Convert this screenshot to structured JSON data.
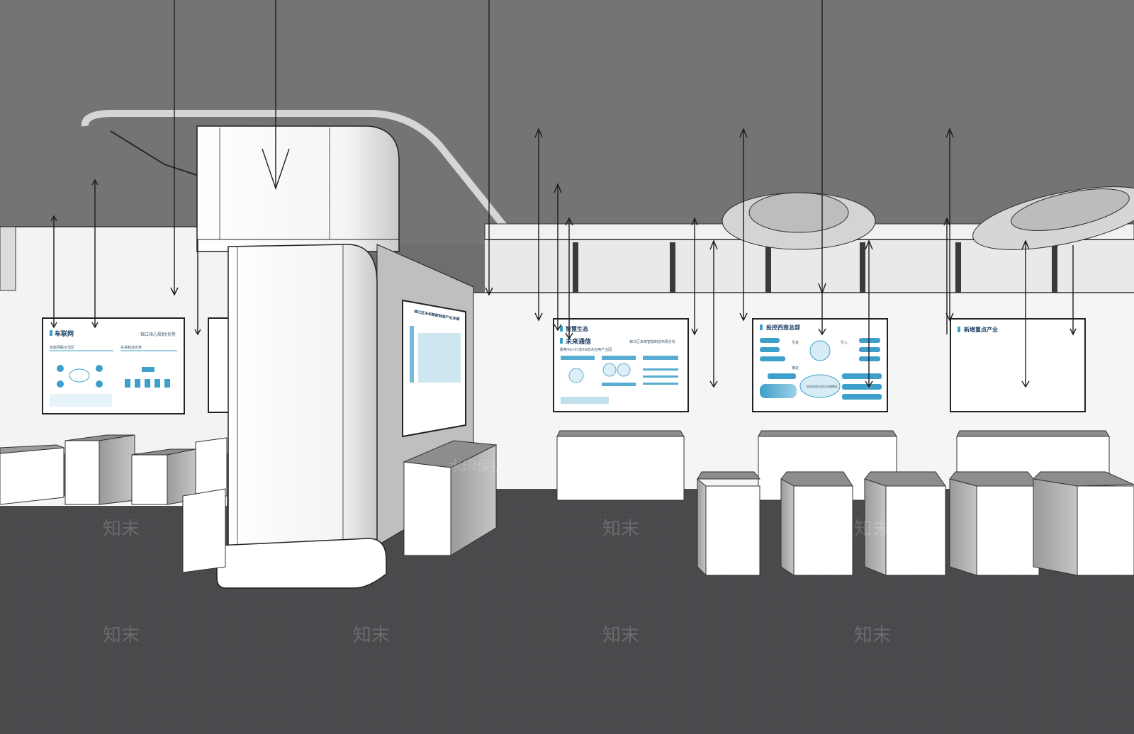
{
  "scene": {
    "colors": {
      "ceiling": "#747474",
      "floor": "#4a4a4d",
      "wall": "#f4f4f4",
      "accent": "#3d9fca",
      "board_title": "#1b3f63"
    }
  },
  "boards": {
    "left": {
      "title": "车联网",
      "right_title": "锦江核心规划/优势",
      "section_1": "智能网联示范区",
      "section_2": "先进制造优势"
    },
    "pillar": {
      "title": "锦江区未来智能制造产业发展"
    },
    "center": {
      "title": "智慧生态",
      "subtitle": "未来通信",
      "right_note": "锦江区未来智能制造布局分析",
      "section": "聚焦5G+打造5G技术应用产业园"
    },
    "right": {
      "title": "投控西南总部",
      "left_label": "引进",
      "right_label": "引入",
      "bottom_label": "推进",
      "center_label": "投控西南总部企业集聚区"
    },
    "far_right": {
      "title": "新增重点产业"
    }
  },
  "watermark": {
    "banner": "水印保护",
    "logo": "知末"
  }
}
